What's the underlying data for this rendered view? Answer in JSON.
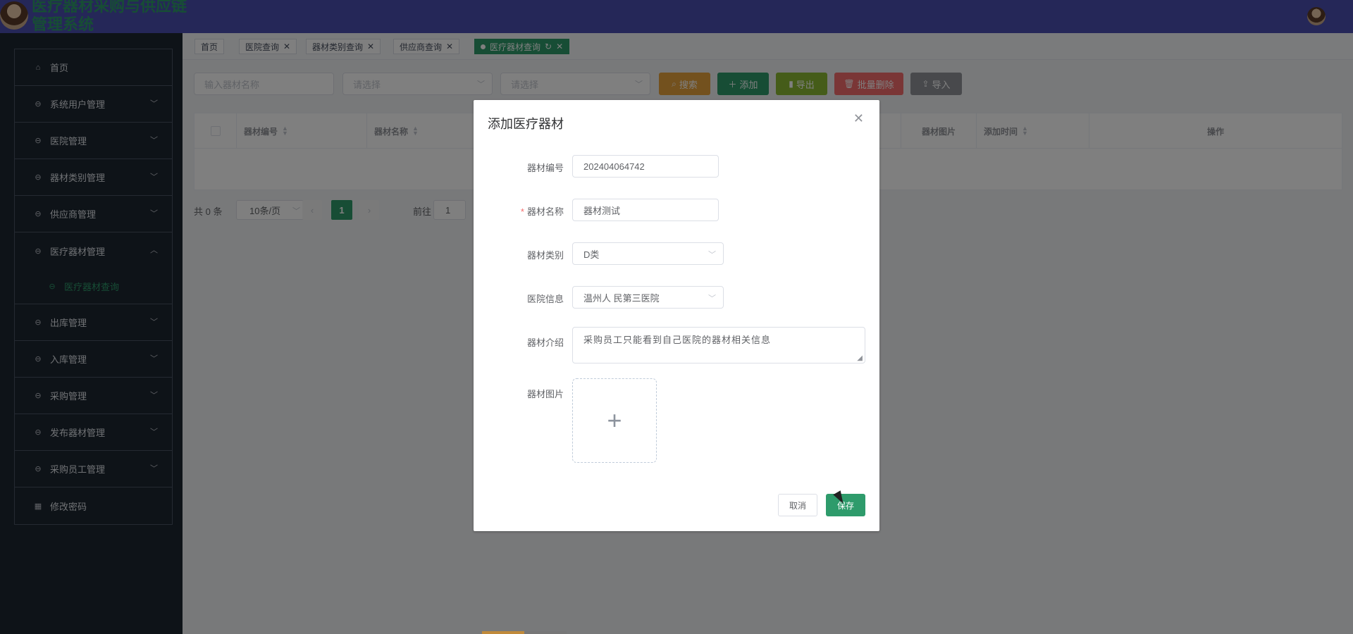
{
  "app": {
    "title": "医疗器材采购与供应链管理系统"
  },
  "sidebar": {
    "items": [
      {
        "label": "首页",
        "icon": "home-icon",
        "chevron": ""
      },
      {
        "label": "系统用户管理",
        "icon": "circle-icon",
        "chevron": "﹀"
      },
      {
        "label": "医院管理",
        "icon": "circle-icon",
        "chevron": "﹀"
      },
      {
        "label": "器材类别管理",
        "icon": "circle-icon",
        "chevron": "﹀"
      },
      {
        "label": "供应商管理",
        "icon": "circle-icon",
        "chevron": "﹀"
      },
      {
        "label": "医疗器材管理",
        "icon": "circle-icon",
        "chevron": "︿"
      },
      {
        "label": "医疗器材查询",
        "icon": "circle-icon",
        "chevron": ""
      },
      {
        "label": "出库管理",
        "icon": "circle-icon",
        "chevron": "﹀"
      },
      {
        "label": "入库管理",
        "icon": "circle-icon",
        "chevron": "﹀"
      },
      {
        "label": "采购管理",
        "icon": "circle-icon",
        "chevron": "﹀"
      },
      {
        "label": "发布器材管理",
        "icon": "circle-icon",
        "chevron": "﹀"
      },
      {
        "label": "采购员工管理",
        "icon": "circle-icon",
        "chevron": "﹀"
      },
      {
        "label": "修改密码",
        "icon": "grid-icon",
        "chevron": ""
      }
    ]
  },
  "tabs": [
    {
      "label": "首页"
    },
    {
      "label": "医院查询"
    },
    {
      "label": "器材类别查询"
    },
    {
      "label": "供应商查询"
    },
    {
      "label": "医疗器材查询"
    }
  ],
  "toolbar": {
    "name_placeholder": "输入器材名称",
    "select1_placeholder": "请选择",
    "select2_placeholder": "请选择",
    "search_label": "搜索",
    "add_label": "添加",
    "export_label": "导出",
    "batch_delete_label": "批量删除",
    "import_label": "导入",
    "colors": {
      "search": "#e6a23c",
      "add": "#2e9b6b",
      "export": "#8ab833",
      "delete": "#f56c6c",
      "import": "#909399"
    }
  },
  "table": {
    "columns": [
      "器材编号",
      "器材名称",
      "器材图片",
      "添加时间",
      "操作"
    ]
  },
  "pagination": {
    "total": "共 0 条",
    "page_size": "10条/页",
    "current_page": "1",
    "goto_label": "前往",
    "goto_value": "1"
  },
  "dialog": {
    "title": "添加医疗器材",
    "fields": {
      "code_label": "器材编号",
      "code_value": "202404064742",
      "name_label": "器材名称",
      "name_value": "器材测试",
      "category_label": "器材类别",
      "category_value": "D类",
      "hospital_label": "医院信息",
      "hospital_value": "温州人 民第三医院",
      "intro_label": "器材介绍",
      "intro_value": "采购员工只能看到自己医院的器材相关信息",
      "image_label": "器材图片",
      "required_mark": "*"
    },
    "cancel_label": "取消",
    "save_label": "保存"
  }
}
